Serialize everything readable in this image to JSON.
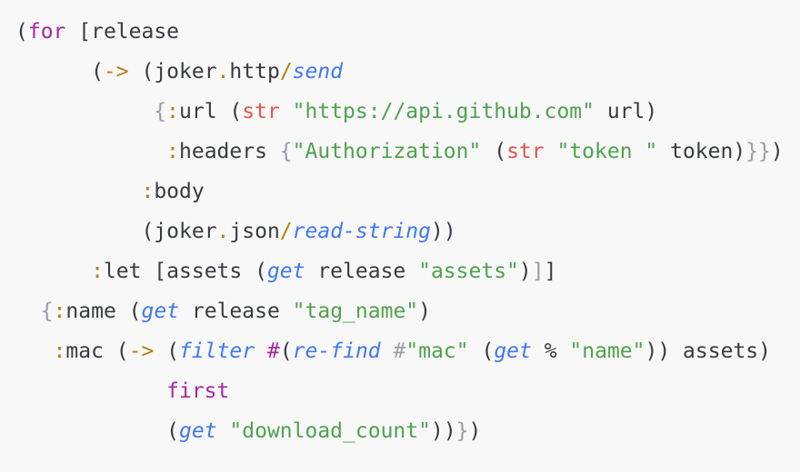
{
  "editor": {
    "colors": {
      "text": "#383a42",
      "keyword": "#a626a4",
      "macro": "#b5800e",
      "function": "#4078f2",
      "builtin": "#e45649",
      "string": "#50a14f",
      "bracket": "#9a9ca3",
      "background": "#f8f8f8"
    },
    "lines": [
      {
        "indent": 0,
        "tokens": [
          [
            "p",
            "("
          ],
          [
            "k",
            "for"
          ],
          [
            "p",
            " [release"
          ]
        ]
      },
      {
        "indent": 6,
        "tokens": [
          [
            "p",
            "("
          ],
          [
            "m",
            "->"
          ],
          [
            "p",
            " (joker"
          ],
          [
            "m",
            "."
          ],
          [
            "p",
            "http"
          ],
          [
            "m",
            "/"
          ],
          [
            "f",
            "send"
          ]
        ]
      },
      {
        "indent": 11,
        "tokens": [
          [
            "b",
            "{"
          ],
          [
            "m",
            ":"
          ],
          [
            "p",
            "url ("
          ],
          [
            "r",
            "str"
          ],
          [
            "p",
            " "
          ],
          [
            "s",
            "\"https://api.github.com\""
          ],
          [
            "p",
            " url)"
          ]
        ]
      },
      {
        "indent": 12,
        "tokens": [
          [
            "m",
            ":"
          ],
          [
            "p",
            "headers "
          ],
          [
            "b",
            "{"
          ],
          [
            "s",
            "\"Authorization\""
          ],
          [
            "p",
            " ("
          ],
          [
            "r",
            "str"
          ],
          [
            "p",
            " "
          ],
          [
            "s",
            "\"token \""
          ],
          [
            "p",
            " token)"
          ],
          [
            "b",
            "}}"
          ],
          [
            "p",
            ")"
          ]
        ]
      },
      {
        "indent": 10,
        "tokens": [
          [
            "m",
            ":"
          ],
          [
            "p",
            "body"
          ]
        ]
      },
      {
        "indent": 10,
        "tokens": [
          [
            "p",
            "(joker"
          ],
          [
            "m",
            "."
          ],
          [
            "p",
            "json"
          ],
          [
            "m",
            "/"
          ],
          [
            "f",
            "read-string"
          ],
          [
            "p",
            "))"
          ]
        ]
      },
      {
        "indent": 6,
        "tokens": [
          [
            "m",
            ":"
          ],
          [
            "p",
            "let [assets ("
          ],
          [
            "f",
            "get"
          ],
          [
            "p",
            " release "
          ],
          [
            "s",
            "\"assets\""
          ],
          [
            "p",
            ")"
          ],
          [
            "b",
            "]"
          ],
          [
            "p",
            "]"
          ]
        ]
      },
      {
        "indent": 2,
        "tokens": [
          [
            "b",
            "{"
          ],
          [
            "m",
            ":"
          ],
          [
            "p",
            "name ("
          ],
          [
            "f",
            "get"
          ],
          [
            "p",
            " release "
          ],
          [
            "s",
            "\"tag_name\""
          ],
          [
            "p",
            ")"
          ]
        ]
      },
      {
        "indent": 3,
        "tokens": [
          [
            "m",
            ":"
          ],
          [
            "p",
            "mac ("
          ],
          [
            "m",
            "->"
          ],
          [
            "p",
            " ("
          ],
          [
            "f",
            "filter"
          ],
          [
            "p",
            " "
          ],
          [
            "k",
            "#"
          ],
          [
            "p",
            "("
          ],
          [
            "f",
            "re-find"
          ],
          [
            "p",
            " "
          ],
          [
            "b",
            "#"
          ],
          [
            "s",
            "\"mac\""
          ],
          [
            "p",
            " ("
          ],
          [
            "f",
            "get"
          ],
          [
            "p",
            " % "
          ],
          [
            "s",
            "\"name\""
          ],
          [
            "p",
            ")) assets)"
          ]
        ]
      },
      {
        "indent": 12,
        "tokens": [
          [
            "k",
            "first"
          ]
        ]
      },
      {
        "indent": 12,
        "tokens": [
          [
            "p",
            "("
          ],
          [
            "f",
            "get"
          ],
          [
            "p",
            " "
          ],
          [
            "s",
            "\"download_count\""
          ],
          [
            "p",
            "))"
          ],
          [
            "b",
            "}"
          ],
          [
            "p",
            ")"
          ]
        ]
      }
    ]
  }
}
